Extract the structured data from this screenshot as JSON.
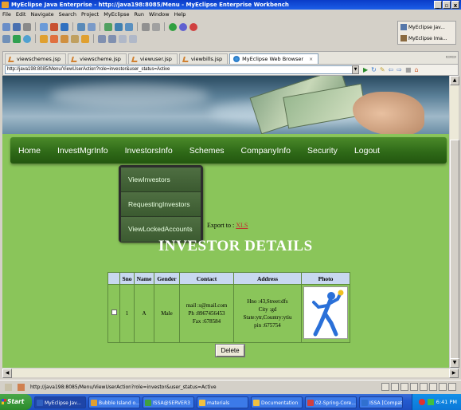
{
  "window": {
    "title": "MyEclipse Java Enterprise - http://java198:8085/Menu - MyEclipse Enterprise Workbench",
    "controls": [
      "_",
      "▫",
      "x"
    ]
  },
  "menubar": [
    "File",
    "Edit",
    "Navigate",
    "Search",
    "Project",
    "MyEclipse",
    "Run",
    "Window",
    "Help"
  ],
  "perspectives": [
    "MyEclipse Jav...",
    "MyEclipse Ima..."
  ],
  "editor_tabs": [
    {
      "label": "viewschemes.jsp",
      "active": false
    },
    {
      "label": "viewscheme.jsp",
      "active": false
    },
    {
      "label": "viewuser.jsp",
      "active": false
    },
    {
      "label": "viewbills.jsp",
      "active": false
    },
    {
      "label": "MyEclipse Web Browser",
      "active": true,
      "close": "×"
    }
  ],
  "browser": {
    "url": "http://java198:8085/Menu/ViewUserAction?role=investor&user_status=Active"
  },
  "nav": {
    "items": [
      "Home",
      "InvestMgrInfo",
      "InvestorsInfo",
      "Schemes",
      "CompanyInfo",
      "Security",
      "Logout"
    ]
  },
  "dropdown": {
    "items": [
      "ViewInvestors",
      "RequestingInvestors",
      "ViewLockedAccounts"
    ]
  },
  "export": {
    "prefix": "Export to :",
    "link": "XLS"
  },
  "page_heading": "INVESTOR DETAILS",
  "table": {
    "headers": [
      "",
      "Sno",
      "Name",
      "Gender",
      "Contact",
      "Address",
      "Photo"
    ],
    "rows": [
      {
        "sno": "1",
        "name": "A",
        "gender": "Male",
        "contact": [
          "mail :s@mail.com",
          "Ph :8967456453",
          "Fax :678584"
        ],
        "address": [
          "Hno :43,Street:dfs",
          "City :gd",
          "State:ytr,Country:ytiu",
          "pin :675754"
        ]
      }
    ]
  },
  "delete_label": "Delete",
  "statusbar": {
    "text": "http://java198:8085/Menu/ViewUserAction?role=investor&user_status=Active"
  },
  "taskbar": {
    "start": "Start",
    "tasks": [
      {
        "label": "MyEclipse Jav...",
        "active": true
      },
      {
        "label": "Bubble Island o...",
        "active": false
      },
      {
        "label": "ISSA@SERVER3",
        "active": false
      },
      {
        "label": "materials",
        "active": false
      },
      {
        "label": "Documentation",
        "active": false
      },
      {
        "label": "02-Spring-Core....",
        "active": false
      },
      {
        "label": "ISSA [Compatibi...",
        "active": false
      }
    ],
    "clock": "6:41 PM"
  }
}
